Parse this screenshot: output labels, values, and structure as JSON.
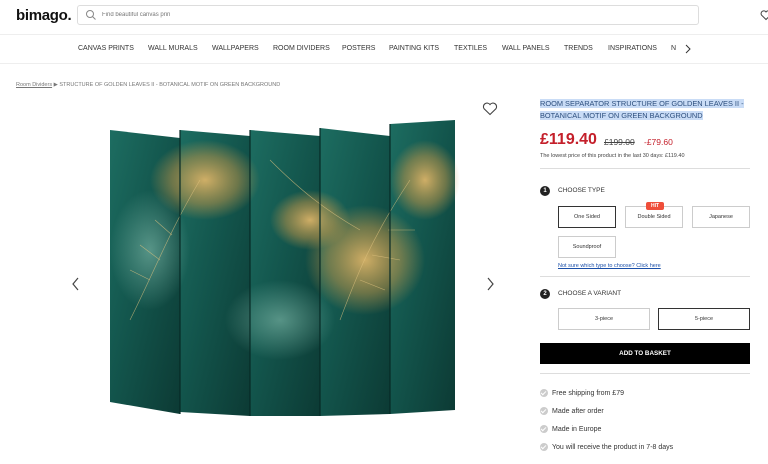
{
  "header": {
    "logo": "bimago.",
    "search_placeholder": "Find beautiful canvas prin"
  },
  "nav": {
    "items": [
      "CANVAS PRINTS",
      "WALL MURALS",
      "WALLPAPERS",
      "ROOM DIVIDERS",
      "POSTERS",
      "PAINTING KITS",
      "TEXTILES",
      "WALL PANELS",
      "TRENDS",
      "INSPIRATIONS",
      "N"
    ]
  },
  "breadcrumb": {
    "parent": "Room Dividers",
    "separator": "▶",
    "current": "STRUCTURE OF GOLDEN LEAVES II - BOTANICAL MOTIF ON GREEN BACKGROUND"
  },
  "product": {
    "title": "ROOM SEPARATOR STRUCTURE OF GOLDEN LEAVES II - BOTANICAL MOTIF ON GREEN BACKGROUND",
    "price": "£119.40",
    "old_price": "£199.00",
    "discount": "-£79.60",
    "lowest_price_note": "The lowest price of this product in the last 30 days: £119.40",
    "image_colors": {
      "base": "#13564d",
      "deep": "#0c3a34",
      "gold": "#c89a4a"
    }
  },
  "type_section": {
    "step": "1",
    "label": "CHOOSE TYPE",
    "options": [
      "One Sided",
      "Double Sided",
      "Japanese",
      "Soundproof"
    ],
    "selected": "One Sided",
    "badge": "HIT",
    "help_link": "Not sure which type to choose? Click here"
  },
  "variant_section": {
    "step": "2",
    "label": "CHOOSE A VARIANT",
    "options": [
      "3-piece",
      "5-piece"
    ],
    "selected": "5-piece"
  },
  "cta": {
    "add_to_basket": "ADD TO BASKET"
  },
  "benefits": [
    "Free shipping from £79",
    "Made after order",
    "Made in Europe",
    "You will receive the product in 7-8 days"
  ]
}
